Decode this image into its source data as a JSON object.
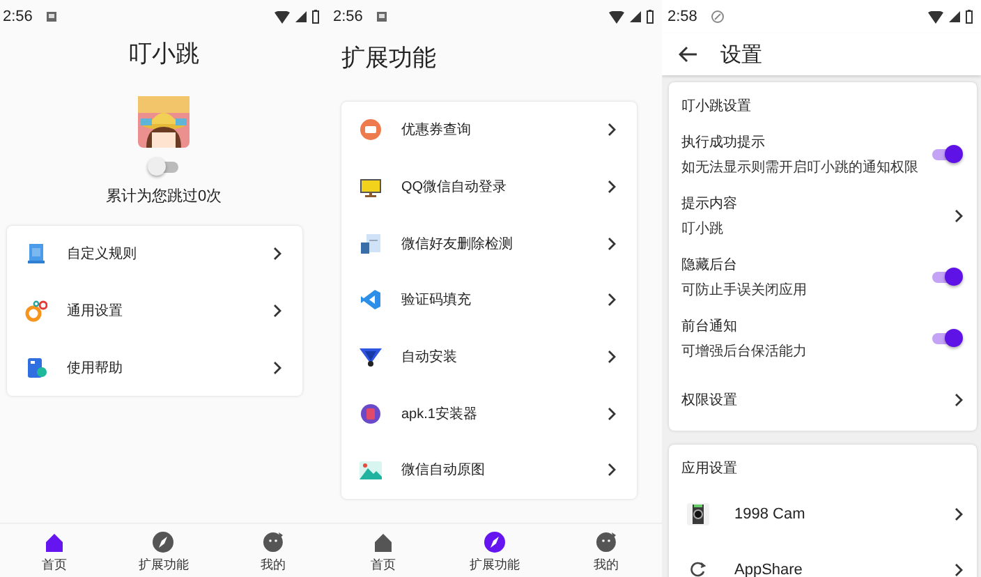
{
  "screens": [
    {
      "kind": "home",
      "status": {
        "time": "2:56"
      },
      "title": "叮小跳",
      "switch": {
        "on": false
      },
      "counter": "累计为您跳过0次",
      "items": [
        {
          "label": "自定义规则"
        },
        {
          "label": "通用设置"
        },
        {
          "label": "使用帮助"
        }
      ],
      "nav": [
        {
          "label": "首页",
          "selected": true
        },
        {
          "label": "扩展功能",
          "selected": false
        },
        {
          "label": "我的",
          "selected": false
        }
      ]
    },
    {
      "kind": "list",
      "status": {
        "time": "2:56"
      },
      "title": "扩展功能",
      "items": [
        {
          "label": "优惠券查询"
        },
        {
          "label": "QQ微信自动登录"
        },
        {
          "label": "微信好友删除检测"
        },
        {
          "label": "验证码填充"
        },
        {
          "label": "自动安装"
        },
        {
          "label": "apk.1安装器"
        },
        {
          "label": "微信自动原图"
        }
      ],
      "nav": [
        {
          "label": "首页",
          "selected": false
        },
        {
          "label": "扩展功能",
          "selected": true
        },
        {
          "label": "我的",
          "selected": false
        }
      ]
    },
    {
      "kind": "settings",
      "status": {
        "time": "2:58"
      },
      "title": "设置",
      "sections": [
        {
          "title": "叮小跳设置",
          "rows": [
            {
              "kind": "toggle",
              "label": "执行成功提示",
              "sub": "如无法显示则需开启叮小跳的通知权限",
              "on": true
            },
            {
              "kind": "link",
              "label": "提示内容",
              "sub": "叮小跳"
            },
            {
              "kind": "toggle",
              "label": "隐藏后台",
              "sub": "可防止手误关闭应用",
              "on": true
            },
            {
              "kind": "toggle",
              "label": "前台通知",
              "sub": "可增强后台保活能力",
              "on": true
            },
            {
              "kind": "link",
              "label": "权限设置"
            }
          ]
        },
        {
          "title": "应用设置",
          "rows": [
            {
              "kind": "app",
              "label": "1998 Cam"
            },
            {
              "kind": "app",
              "label": "AppShare"
            }
          ]
        }
      ]
    }
  ]
}
